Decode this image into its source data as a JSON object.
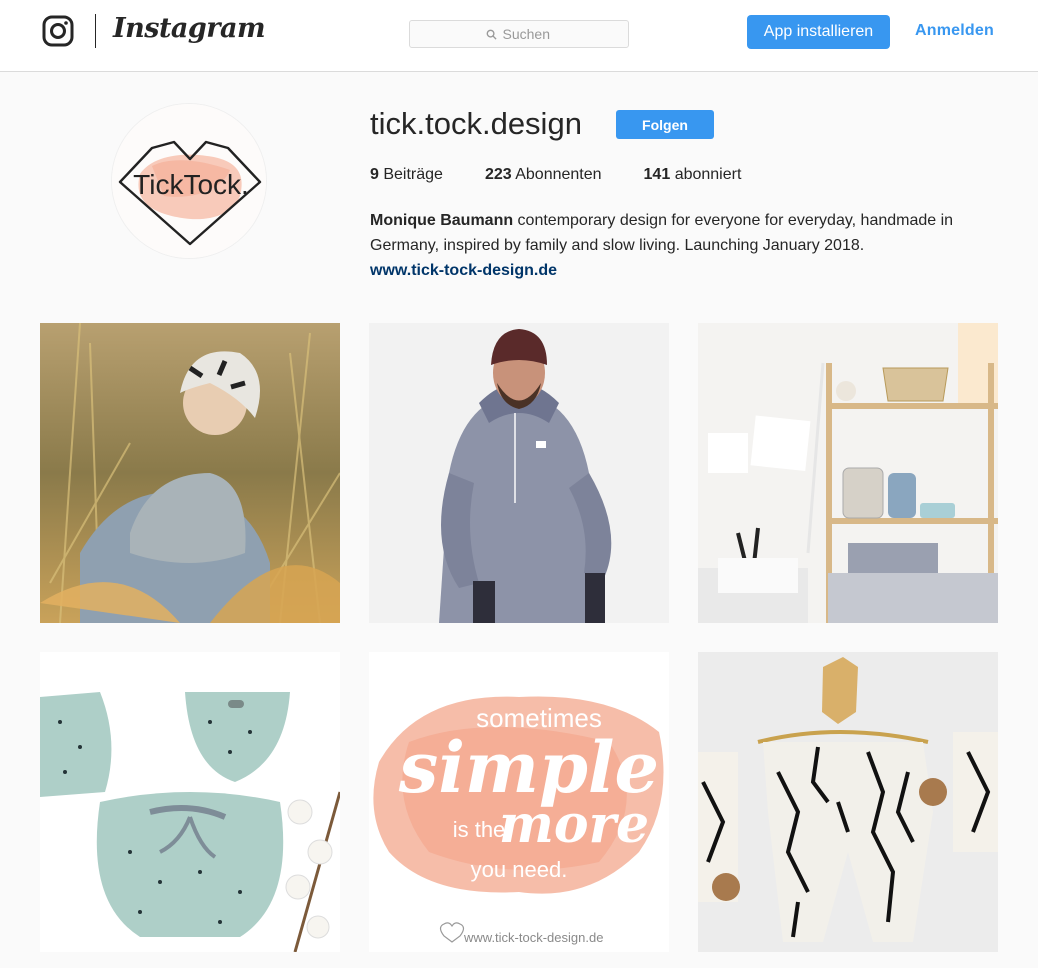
{
  "header": {
    "brand_wordmark": "Instagram",
    "search": {
      "placeholder": "Suchen",
      "value": ""
    },
    "install_label": "App installieren",
    "login_label": "Anmelden",
    "colors": {
      "accent": "#3897f0",
      "border": "#dbdbdb",
      "bg": "#fafafa"
    }
  },
  "profile": {
    "username": "tick.tock.design",
    "follow_label": "Folgen",
    "avatar_text": "TickTock.",
    "stats": [
      {
        "count": "9",
        "label": "Beiträge"
      },
      {
        "count": "223",
        "label": "Abonnenten"
      },
      {
        "count": "141",
        "label": "abonniert"
      }
    ],
    "bio": {
      "name": "Monique Baumann",
      "text": " contemporary design for everyone for everyday, handmade in Germany, inspired by family and slow living. Launching January 2018.",
      "link": "www.tick-tock-design.de"
    }
  },
  "posts": [
    {
      "subject": "child-in-grass"
    },
    {
      "subject": "man-in-hoodie"
    },
    {
      "subject": "shelf-with-jars"
    },
    {
      "subject": "mint-baby-clothes"
    },
    {
      "subject": "quote-graphic",
      "quote_line1": "sometimes",
      "quote_line2": "simple",
      "quote_line3": "is the",
      "quote_line4": "more",
      "quote_line5": "you need.",
      "watermark": "www.tick-tock-design.de"
    },
    {
      "subject": "marble-print-pants"
    }
  ]
}
